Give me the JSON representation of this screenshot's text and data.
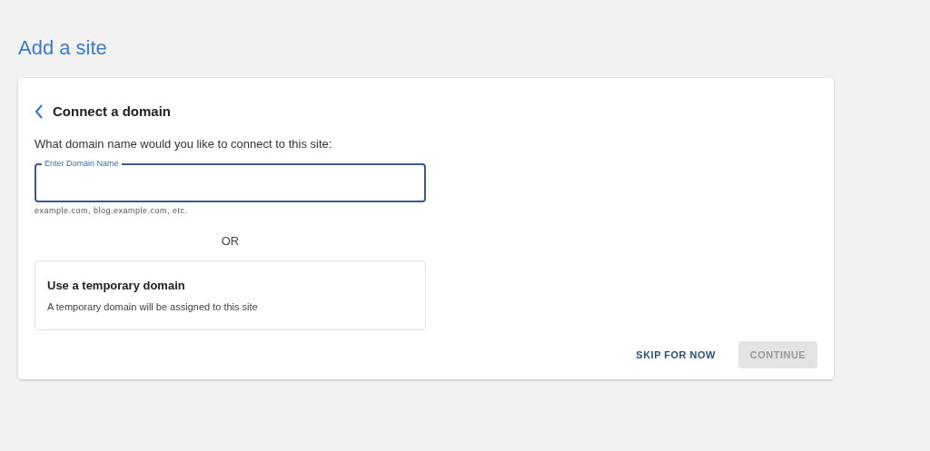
{
  "page_title": "Add a site",
  "card": {
    "heading": "Connect a domain",
    "question": "What domain name would you like to connect to this site:",
    "domain_field": {
      "label": "Enter Domain Name",
      "focused": true,
      "helper": "example.com, blog.example.com, etc."
    },
    "separator": "OR",
    "option": {
      "title": "Use a temporary domain",
      "description": "A temporary domain will be assigned to this site",
      "selected": false
    },
    "buttons": [
      {
        "kind": "text",
        "label": "SKIP FOR NOW",
        "disabled": false
      },
      {
        "kind": "filled",
        "label": "CONTINUE",
        "disabled": true
      }
    ]
  }
}
